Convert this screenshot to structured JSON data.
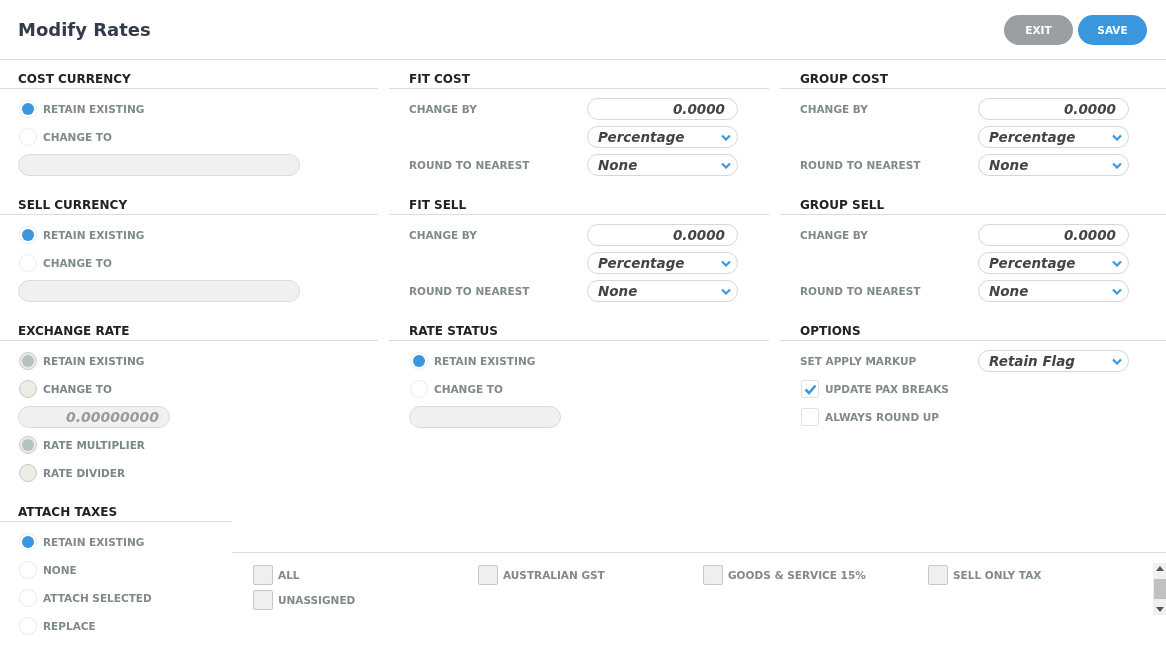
{
  "header": {
    "title": "Modify Rates",
    "buttons": [
      {
        "label": "EXIT",
        "kind": "secondary"
      },
      {
        "label": "SAVE",
        "kind": "primary"
      }
    ]
  },
  "columns": [
    [
      {
        "title": "COST CURRENCY",
        "items": [
          {
            "kind": "radio",
            "label": "RETAIN EXISTING",
            "selected": true
          },
          {
            "kind": "radio",
            "label": "CHANGE TO",
            "selected": false
          },
          {
            "kind": "field"
          }
        ]
      },
      {
        "title": "SELL CURRENCY",
        "items": [
          {
            "kind": "radio",
            "label": "RETAIN EXISTING",
            "selected": true
          },
          {
            "kind": "radio",
            "label": "CHANGE TO",
            "selected": false
          },
          {
            "kind": "field"
          }
        ]
      },
      {
        "title": "EXCHANGE RATE",
        "disabled": true,
        "items": [
          {
            "kind": "radio",
            "label": "RETAIN EXISTING",
            "selected": true
          },
          {
            "kind": "radio",
            "label": "CHANGE TO",
            "selected": false
          },
          {
            "kind": "field",
            "placeholder": "0.00000000"
          },
          {
            "kind": "radio",
            "label": "RATE MULTIPLIER",
            "selected": true
          },
          {
            "kind": "radio",
            "label": "RATE DIVIDER",
            "selected": false
          }
        ]
      }
    ],
    [
      {
        "title": "FIT COST",
        "items": [
          {
            "kind": "number",
            "label": "CHANGE BY",
            "value": "0.0000"
          },
          {
            "kind": "select",
            "value": "Percentage"
          },
          {
            "kind": "select",
            "label": "ROUND TO NEAREST",
            "value": "None"
          }
        ]
      },
      {
        "title": "FIT SELL",
        "items": [
          {
            "kind": "number",
            "label": "CHANGE BY",
            "value": "0.0000"
          },
          {
            "kind": "select",
            "value": "Percentage"
          },
          {
            "kind": "select",
            "label": "ROUND TO NEAREST",
            "value": "None"
          }
        ]
      },
      {
        "title": "RATE STATUS",
        "items": [
          {
            "kind": "radio",
            "label": "RETAIN EXISTING",
            "selected": true
          },
          {
            "kind": "radio",
            "label": "CHANGE TO",
            "selected": false
          },
          {
            "kind": "field"
          }
        ]
      }
    ],
    [
      {
        "title": "GROUP COST",
        "items": [
          {
            "kind": "number",
            "label": "CHANGE BY",
            "value": "0.0000"
          },
          {
            "kind": "select",
            "value": "Percentage"
          },
          {
            "kind": "select",
            "label": "ROUND TO NEAREST",
            "value": "None"
          }
        ]
      },
      {
        "title": "GROUP SELL",
        "items": [
          {
            "kind": "number",
            "label": "CHANGE BY",
            "value": "0.0000"
          },
          {
            "kind": "select",
            "value": "Percentage"
          },
          {
            "kind": "select",
            "label": "ROUND TO NEAREST",
            "value": "None"
          }
        ]
      },
      {
        "title": "OPTIONS",
        "items": [
          {
            "kind": "select",
            "label": "SET APPLY MARKUP",
            "value": "Retain Flag"
          },
          {
            "kind": "checkbox",
            "label": "UPDATE PAX BREAKS",
            "checked": true
          },
          {
            "kind": "checkbox",
            "label": "ALWAYS ROUND UP",
            "checked": false
          }
        ]
      }
    ]
  ],
  "attach_taxes": {
    "title": "ATTACH TAXES",
    "options": [
      {
        "label": "RETAIN EXISTING",
        "selected": true
      },
      {
        "label": "NONE",
        "selected": false
      },
      {
        "label": "ATTACH SELECTED",
        "selected": false
      },
      {
        "label": "REPLACE",
        "selected": false
      }
    ],
    "taxes": [
      {
        "label": "ALL",
        "checked": false
      },
      {
        "label": "AUSTRALIAN GST",
        "checked": false
      },
      {
        "label": "GOODS & SERVICE 15%",
        "checked": false
      },
      {
        "label": "SELL ONLY TAX",
        "checked": false
      },
      {
        "label": "UNASSIGNED",
        "checked": false
      }
    ]
  }
}
